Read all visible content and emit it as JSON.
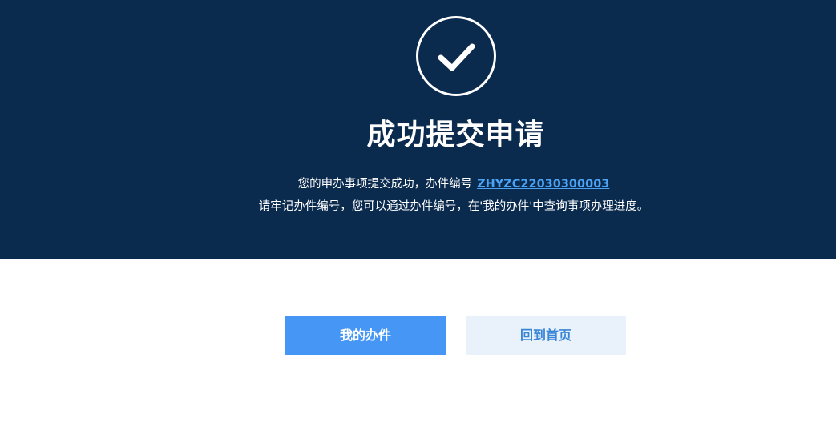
{
  "banner": {
    "title": "成功提交申请",
    "line1_text": "您的申办事项提交成功，办件编号",
    "line1_code": "ZHYZC22030300003",
    "line2_text": "请牢记办件编号，您可以通过办件编号，在'我的办件'中查询事项办理进度。",
    "icon": "check-circle-icon"
  },
  "actions": {
    "my_cases_label": "我的办件",
    "home_label": "回到首页"
  },
  "colors": {
    "banner_bg": "#0a2a4e",
    "link": "#4aa3f5",
    "primary_button": "#4696f5",
    "secondary_button_bg": "#e9f2fb",
    "secondary_button_text": "#3a86d6"
  }
}
